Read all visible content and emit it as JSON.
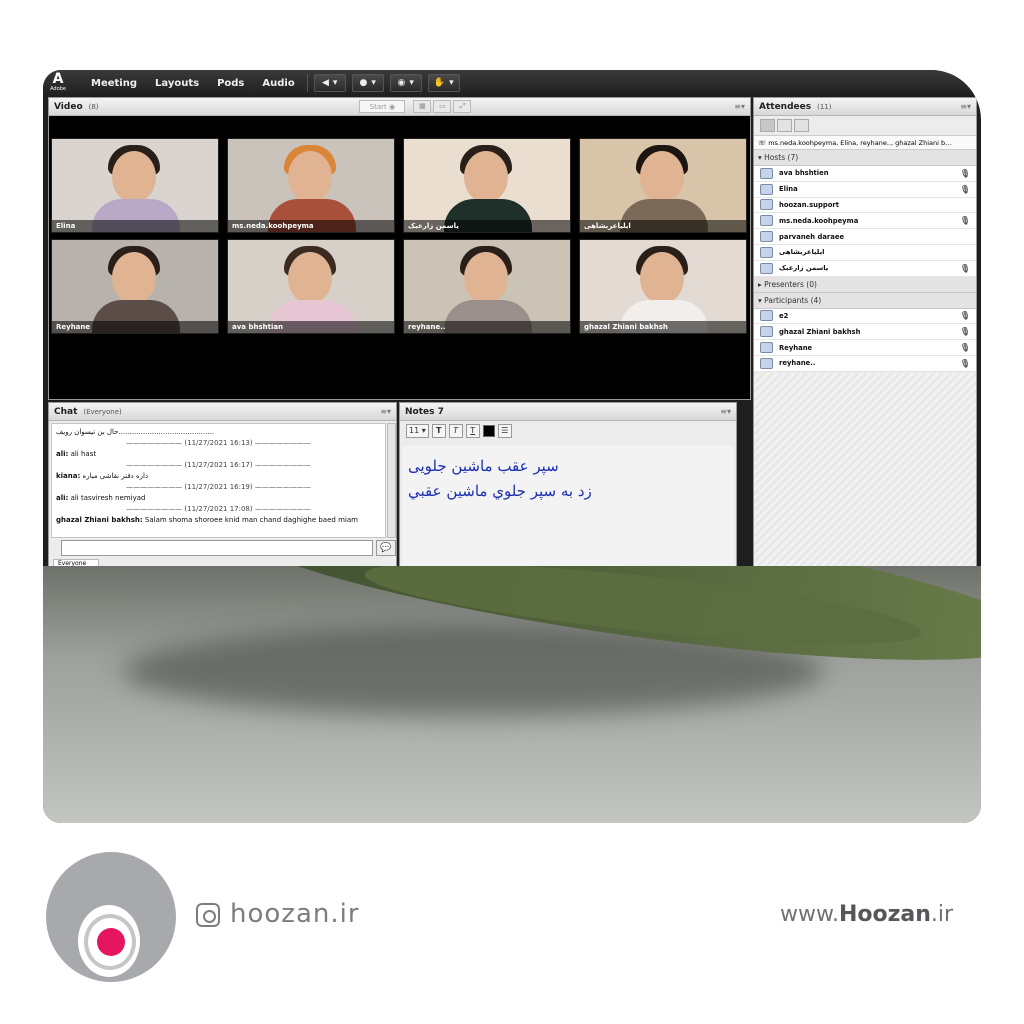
{
  "menubar": {
    "logo": "Adobe",
    "items": [
      "Meeting",
      "Layouts",
      "Pods",
      "Audio"
    ]
  },
  "video": {
    "title": "Video",
    "count": "(8)",
    "start_label": "Start",
    "tiles": [
      {
        "name": "Elina",
        "bg": "#d9d4cf",
        "body": "#b9a9c7",
        "hair": "#2a1f18"
      },
      {
        "name": "ms.neda.koohpeyma",
        "bg": "#c9c3bc",
        "body": "#a8503a",
        "hair": "#d9853a"
      },
      {
        "name": "یاسمن زارعیک",
        "bg": "#e9ded0",
        "body": "#1f2f2a",
        "hair": "#2a1f18"
      },
      {
        "name": "ایلیاعربشاهی",
        "bg": "#d8c4a8",
        "body": "#7b6a58",
        "hair": "#1c1410"
      },
      {
        "name": "Reyhane",
        "bg": "#b8b2ac",
        "body": "#5d4d48",
        "hair": "#2a1f18"
      },
      {
        "name": "ava bhshtian",
        "bg": "#d6d0c8",
        "body": "#e5c6d2",
        "hair": "#3a2a20"
      },
      {
        "name": "reyhane..",
        "bg": "#cbc3b6",
        "body": "#9a8f8a",
        "hair": "#2a1f18"
      },
      {
        "name": "ghazal Zhiani bakhsh",
        "bg": "#e3dbd3",
        "body": "#f1eeec",
        "hair": "#2a1f18"
      }
    ]
  },
  "chat": {
    "title": "Chat",
    "scope": "(Everyone)",
    "lines": [
      {
        "type": "msg",
        "text": "حال بن تیسوان رویف..........................................."
      },
      {
        "type": "sep",
        "text": "———————— (11/27/2021 16:13) ————————"
      },
      {
        "type": "msg",
        "sender": "ali:",
        "text": "ali hast"
      },
      {
        "type": "sep",
        "text": "———————— (11/27/2021 16:17) ————————"
      },
      {
        "type": "msg",
        "sender": "kiana:",
        "text": "داره دفتر نقاشی میاره"
      },
      {
        "type": "sep",
        "text": "———————— (11/27/2021 16:19) ————————"
      },
      {
        "type": "msg",
        "sender": "ali:",
        "text": "ali tasviresh nemiyad"
      },
      {
        "type": "sep",
        "text": "———————— (11/27/2021 17:08) ————————"
      },
      {
        "type": "msg",
        "sender": "ghazal Zhiani bakhsh:",
        "text": "Salam shoma shoroee knid man chand daghighe baed miam"
      }
    ],
    "tab_label": "Everyone"
  },
  "notes": {
    "title": "Notes 7",
    "font_size": "11",
    "line1": "سپر عقب ماشین جلویی",
    "line2": "زد به سپر جلوي ماشین عقبي"
  },
  "attendees": {
    "title": "Attendees",
    "count": "(11)",
    "banner": "ms.neda.koohpeyma, Elina, reyhane.., ghazal Zhiani b...",
    "hosts_label": "Hosts (7)",
    "hosts": [
      "ava bhshtien",
      "Elina",
      "hoozan.support",
      "ms.neda.koohpeyma",
      "parvaneh daraee",
      "ایلیاعربشاهی",
      "یاسمن زارعیک"
    ],
    "presenters_label": "Presenters (0)",
    "participants_label": "Participants (4)",
    "participants": [
      "e2",
      "ghazal Zhiani bakhsh",
      "Reyhane",
      "reyhane.."
    ]
  },
  "footer": {
    "instagram": "hoozan.ir",
    "website_prefix": "www.",
    "website_brand": "Hoozan",
    "website_suffix": ".ir"
  },
  "colors": {
    "brand_pink": "#e5155f",
    "brand_gray": "#a7a9ac",
    "notes_text": "#1a2fb0"
  }
}
